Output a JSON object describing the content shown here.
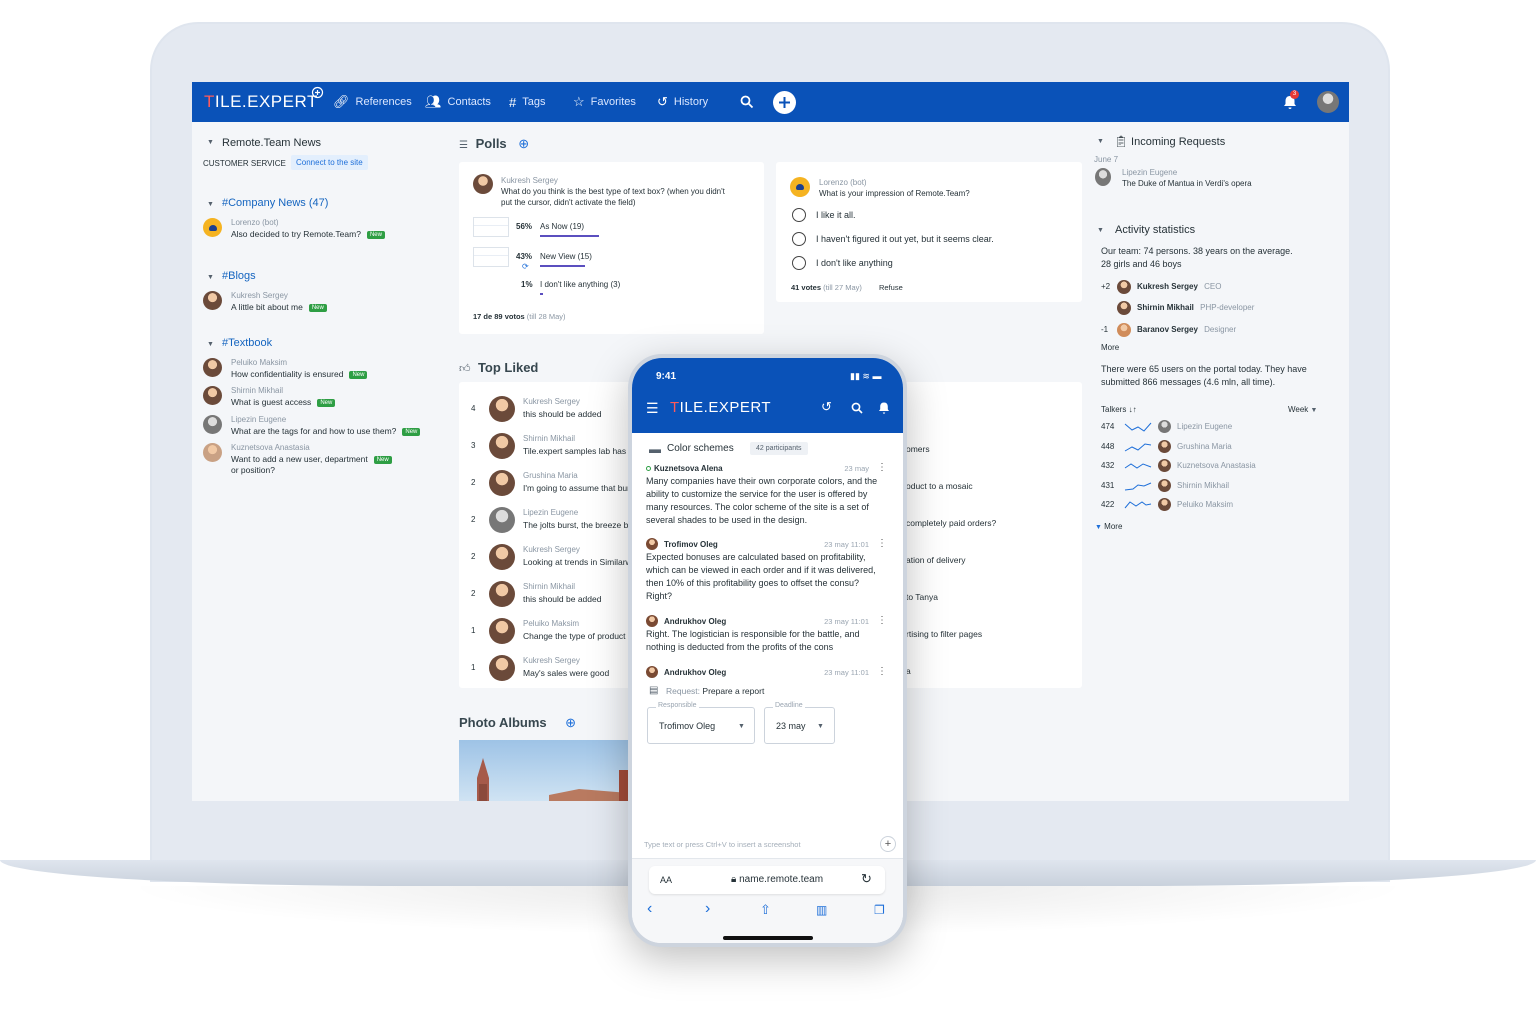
{
  "nav": {
    "logo": "TILE.EXPERT",
    "logo_first": "T",
    "logo_rest": "ILE.EXPERT",
    "items": [
      {
        "label": "References",
        "icon": "link-icon"
      },
      {
        "label": "Contacts",
        "icon": "people-icon"
      },
      {
        "label": "Tags",
        "icon": "hash-icon"
      },
      {
        "label": "Favorites",
        "icon": "star-icon"
      },
      {
        "label": "History",
        "icon": "history-icon"
      }
    ],
    "notif_count": "3"
  },
  "left": {
    "news_title": "Remote.Team News",
    "customer_service": "CUSTOMER SERVICE",
    "connect_label": "Connect to the site",
    "company_news": "#Company News (47)",
    "company_items": [
      {
        "name": "Lorenzo (bot)",
        "text": "Also decided to try Remote.Team?",
        "badge": "New"
      }
    ],
    "blogs": "#Blogs",
    "blog_items": [
      {
        "name": "Kukresh Sergey",
        "text": "A little bit about me",
        "badge": "New"
      }
    ],
    "textbook": "#Textbook",
    "textbook_items": [
      {
        "name": "Peluiko Maksim",
        "text": "How confidentiality is ensured",
        "badge": "New"
      },
      {
        "name": "Shirnin Mikhail",
        "text": "What is guest access",
        "badge": "New"
      },
      {
        "name": "Lipezin Eugene",
        "text": "What are the tags for and how to use them?",
        "badge": "New"
      },
      {
        "name": "Kuznetsova Anastasia",
        "text": "Want to add a new user, department",
        "text2": "or position?",
        "badge": "New"
      }
    ]
  },
  "polls": {
    "title": "Polls",
    "poll1": {
      "author": "Kukresh Sergey",
      "question": "What do you think is the best type of text box? (when you didn't",
      "question2": "put the cursor, didn't activate the field)",
      "options": [
        {
          "pct": "56%",
          "label": "As Now (19)",
          "value": 56
        },
        {
          "pct": "43%",
          "label": "New View (15)",
          "value": 43
        },
        {
          "pct": "1%",
          "label": "I don't like anything (3)",
          "value": 1
        }
      ],
      "votes": "17 de 89 votos",
      "till": "(till 28 May)"
    },
    "poll2": {
      "author": "Lorenzo (bot)",
      "question": "What is your impression of Remote.Team?",
      "options": [
        "I like it all.",
        "I haven't figured it out yet, but it seems clear.",
        "I don't like anything"
      ],
      "votes": "41 votes",
      "till": "(till 27 May)",
      "refuse": "Refuse"
    }
  },
  "top_liked": {
    "title": "Top Liked",
    "rows": [
      {
        "count": "4",
        "name": "Kukresh Sergey",
        "text": "this should be added"
      },
      {
        "count": "3",
        "name": "Shirnin Mikhail",
        "text": "Tile.expert samples lab has ar"
      },
      {
        "count": "2",
        "name": "Grushina Maria",
        "text": "I'm going to assume that bur"
      },
      {
        "count": "2",
        "name": "Lipezin Eugene",
        "text": "The jolts burst, the breeze bl"
      },
      {
        "count": "2",
        "name": "Kukresh Sergey",
        "text": "Looking at trends in Similarw"
      },
      {
        "count": "2",
        "name": "Shirnin Mikhail",
        "text": "this should be added"
      },
      {
        "count": "1",
        "name": "Peluiko Maksim",
        "text": "Change the type of product"
      },
      {
        "count": "1",
        "name": "Kukresh Sergey",
        "text": "May's sales were good"
      }
    ],
    "right_col": [
      "omers",
      "oduct to a mosaic",
      "completely paid orders?",
      "ation of delivery",
      "to Tanya",
      "rtising to filter pages",
      "a"
    ]
  },
  "photo_albums": {
    "title": "Photo Albums"
  },
  "right": {
    "incoming_title": "Incoming Requests",
    "date": "June 7",
    "request_name": "Lipezin Eugene",
    "request_text": "The Duke of Mantua in Verdi's opera",
    "activity_title": "Activity statistics",
    "team_line1": "Our team: 74 persons. 38 years on the average.",
    "team_line2": "28 girls and 46 boys",
    "people": [
      {
        "delta": "+2",
        "name": "Kukresh Sergey",
        "role": "CEO"
      },
      {
        "delta": "",
        "name": "Shirnin Mikhail",
        "role": "PHP-developer"
      },
      {
        "delta": "-1",
        "name": "Baranov Sergey",
        "role": "Designer"
      }
    ],
    "more": "More",
    "users_line1": "There were 65 users on the portal today. They have",
    "users_line2": "submitted 866 messages (4.6 mln, all time).",
    "talkers_label": "Talkers ↓↑",
    "week_label": "Week",
    "talkers": [
      {
        "count": "474",
        "name": "Lipezin Eugene"
      },
      {
        "count": "448",
        "name": "Grushina Maria"
      },
      {
        "count": "432",
        "name": "Kuznetsova Anastasia"
      },
      {
        "count": "431",
        "name": "Shirnin Mikhail"
      },
      {
        "count": "422",
        "name": "Peluiko Maksim"
      }
    ],
    "more2": "More"
  },
  "phone": {
    "time": "9:41",
    "logo": "TILE.EXPERT",
    "logo_first": "T",
    "logo_rest": "ILE.EXPERT",
    "channel": "Color schemes",
    "participants": "42 participants",
    "messages": [
      {
        "name": "Kuznetsova Alena",
        "time": "23 may",
        "text": [
          "Many companies have their own corporate colors, and the",
          "ability to customize the service for the user is offered by",
          "many resources. The color scheme of the site is a set of",
          "several shades to be used in the design."
        ]
      },
      {
        "name": "Trofimov Oleg",
        "time": "23 may 11:01",
        "text": [
          "Expected bonuses are calculated based on profitability,",
          "which can be viewed in each order and if it was delivered,",
          "then 10% of this profitability goes to offset the consu?",
          "Right?"
        ]
      },
      {
        "name": "Andrukhov Oleg",
        "time": "23 may 11:01",
        "text": [
          "Right. The logistician is responsible for the battle, and",
          "nothing is deducted from the profits of the cons"
        ]
      },
      {
        "name": "Andrukhov Oleg",
        "time": "23 may 11:01",
        "text": []
      }
    ],
    "request_prefix": "Request:",
    "request_text": "Prepare a report",
    "responsible_label": "Responsible",
    "responsible_value": "Trofimov Oleg",
    "deadline_label": "Deadline",
    "deadline_value": "23 may",
    "input_placeholder": "Type text or press Ctrl+V to insert a screenshot",
    "aa": "AA",
    "url": "name.remote.team"
  }
}
